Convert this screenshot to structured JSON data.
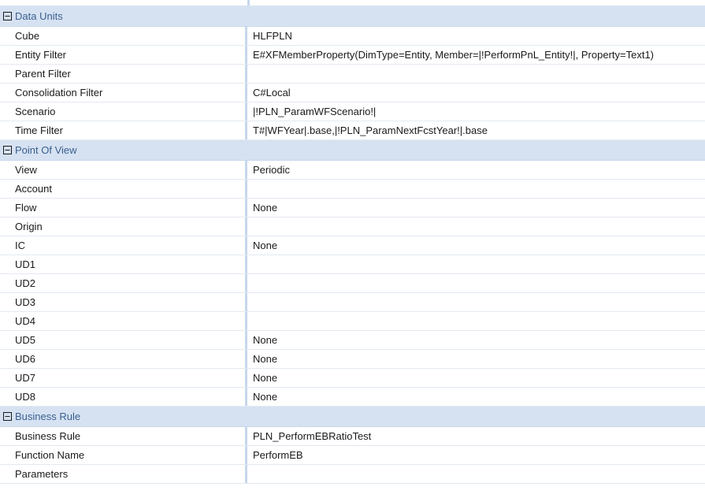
{
  "sections": [
    {
      "title": "Data Units",
      "rows": [
        {
          "name": "Cube",
          "value": "HLFPLN"
        },
        {
          "name": "Entity Filter",
          "value": "E#XFMemberProperty(DimType=Entity, Member=|!PerformPnL_Entity!|, Property=Text1)"
        },
        {
          "name": "Parent Filter",
          "value": ""
        },
        {
          "name": "Consolidation Filter",
          "value": "C#Local"
        },
        {
          "name": "Scenario",
          "value": "|!PLN_ParamWFScenario!|"
        },
        {
          "name": "Time Filter",
          "value": "T#|WFYear|.base,|!PLN_ParamNextFcstYear!|.base"
        }
      ]
    },
    {
      "title": "Point Of View",
      "rows": [
        {
          "name": "View",
          "value": "Periodic"
        },
        {
          "name": "Account",
          "value": ""
        },
        {
          "name": "Flow",
          "value": "None"
        },
        {
          "name": "Origin",
          "value": ""
        },
        {
          "name": "IC",
          "value": "None"
        },
        {
          "name": "UD1",
          "value": ""
        },
        {
          "name": "UD2",
          "value": ""
        },
        {
          "name": "UD3",
          "value": ""
        },
        {
          "name": "UD4",
          "value": ""
        },
        {
          "name": "UD5",
          "value": "None"
        },
        {
          "name": "UD6",
          "value": "None"
        },
        {
          "name": "UD7",
          "value": "None"
        },
        {
          "name": "UD8",
          "value": "None"
        }
      ]
    },
    {
      "title": "Business Rule",
      "rows": [
        {
          "name": "Business Rule",
          "value": "PLN_PerformEBRatioTest"
        },
        {
          "name": "Function Name",
          "value": "PerformEB"
        },
        {
          "name": "Parameters",
          "value": ""
        }
      ]
    }
  ],
  "icons": {
    "collapse": "collapse-minus-icon"
  },
  "colors": {
    "category_bg": "#d6e2f2",
    "category_text": "#3b5f8f",
    "divider": "#c7d7ec"
  }
}
